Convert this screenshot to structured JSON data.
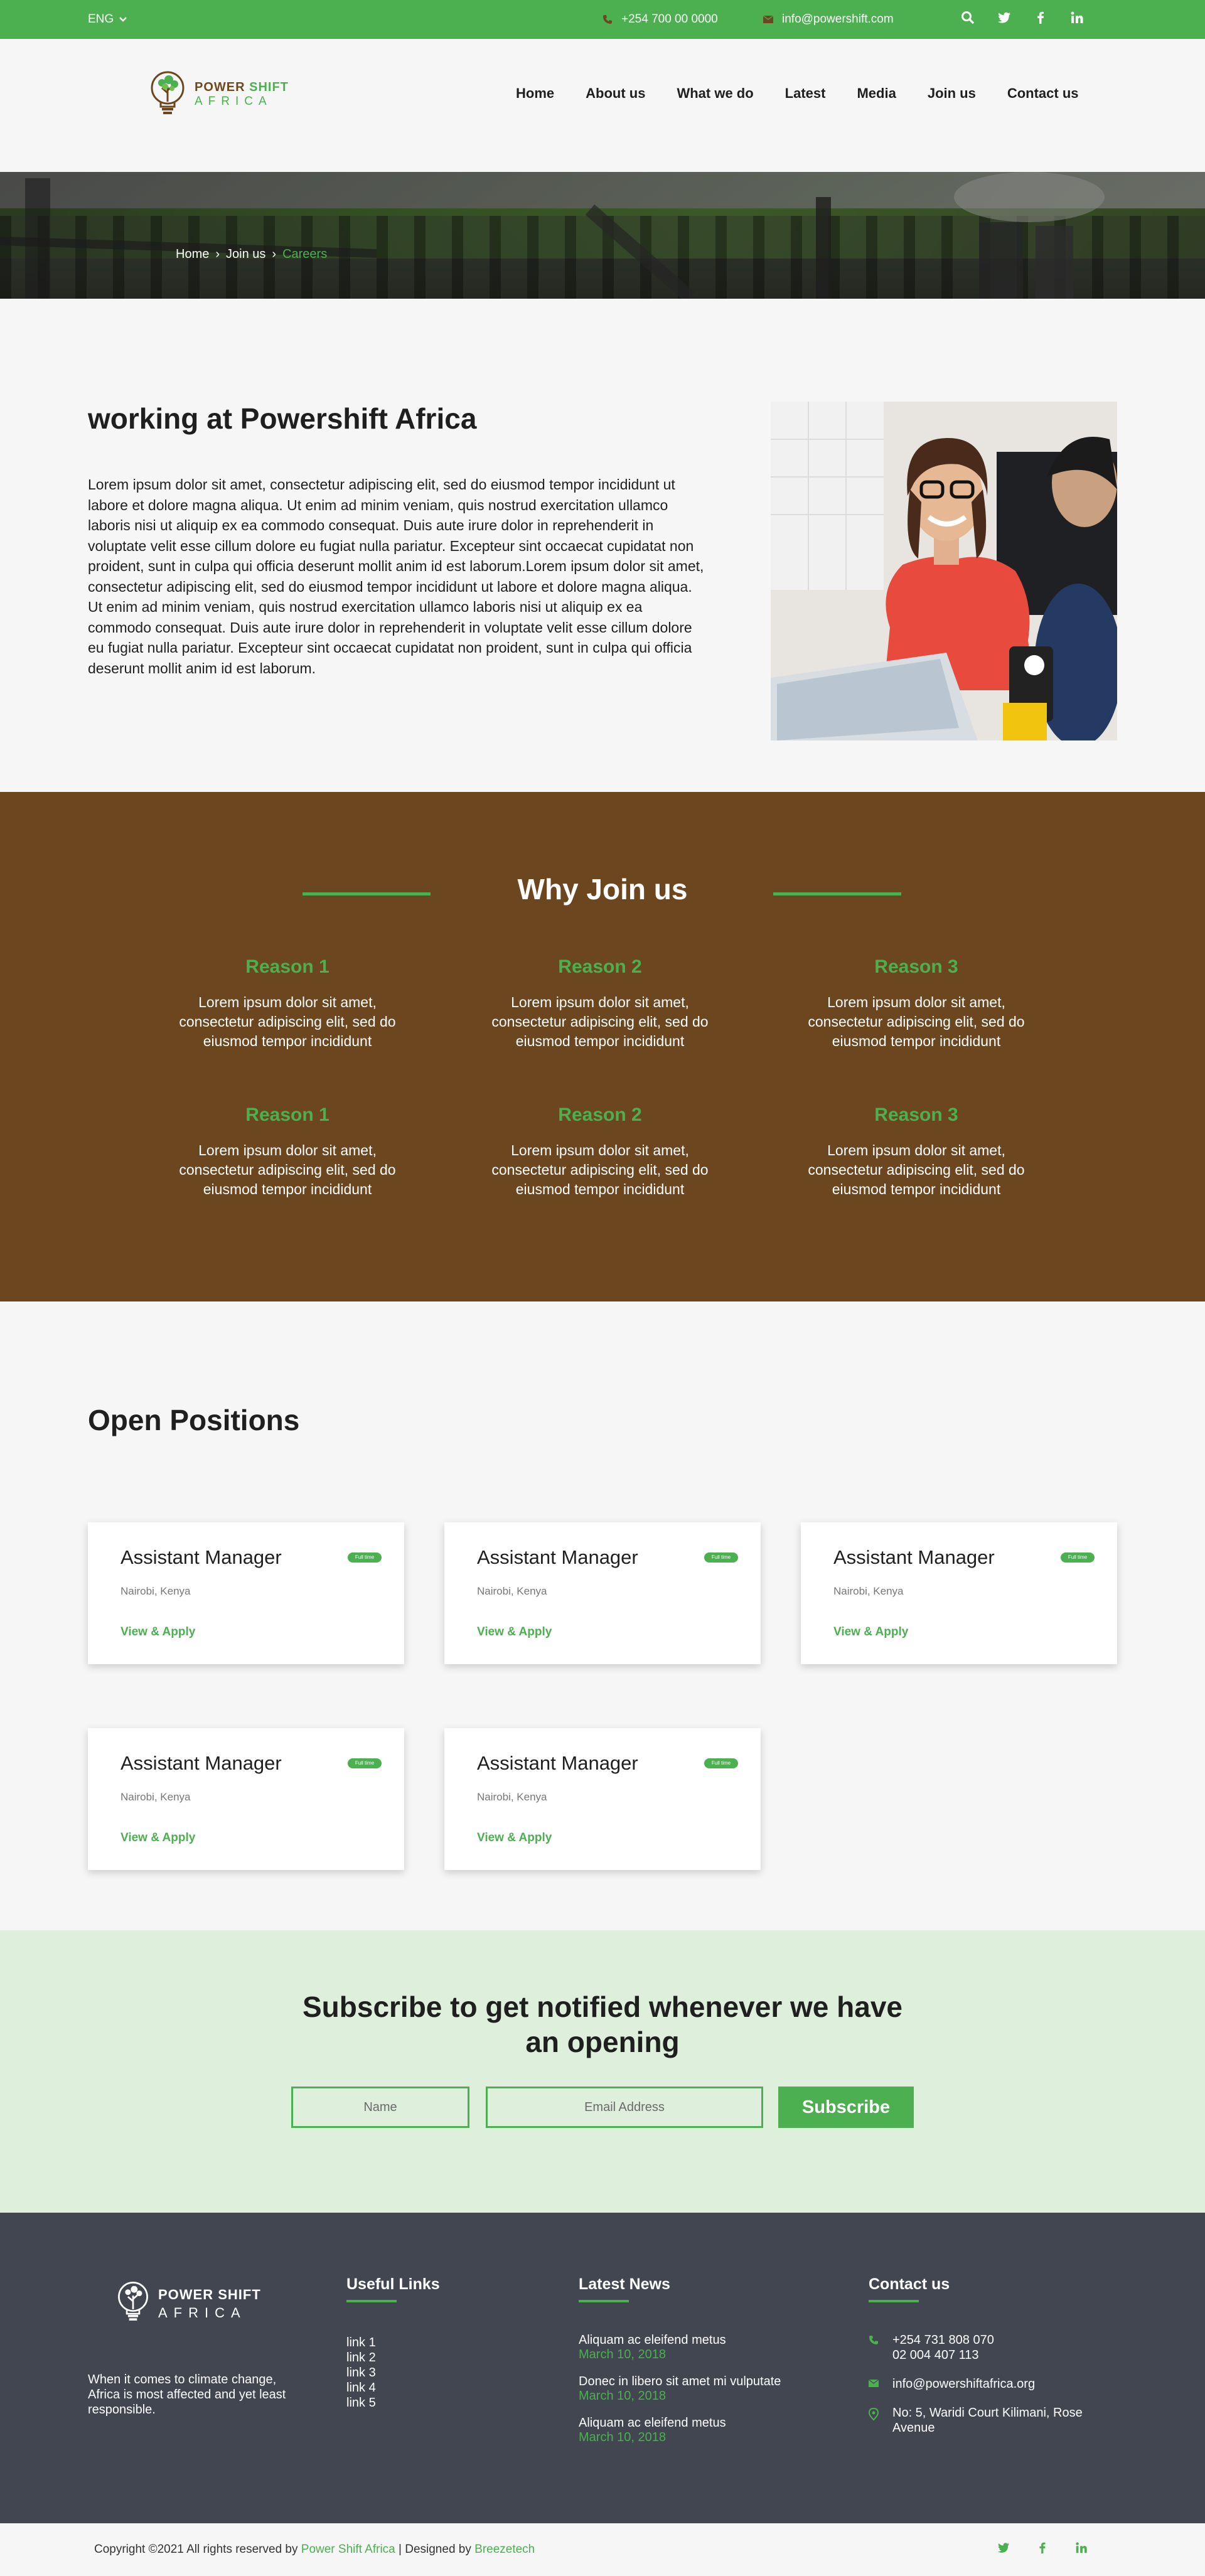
{
  "topbar": {
    "language": "ENG",
    "phone": "+254 700 00 0000",
    "email": "info@powershift.com",
    "icons": [
      "search-icon",
      "twitter-icon",
      "facebook-icon",
      "linkedin-icon"
    ]
  },
  "header": {
    "logo_line1_a": "POWER",
    "logo_line1_b": "SHIFT",
    "logo_line2": "AFRICA",
    "nav": [
      "Home",
      "About us",
      "What we do",
      "Latest",
      "Media",
      "Join us",
      "Contact us"
    ]
  },
  "breadcrumb": {
    "home": "Home",
    "join": "Join us",
    "current": "Careers",
    "separator": "›"
  },
  "working": {
    "title": "working at Powershift Africa",
    "body": "Lorem ipsum dolor sit amet, consectetur adipiscing elit, sed do eiusmod tempor incididunt ut labore et dolore magna aliqua. Ut enim ad minim veniam, quis nostrud exercitation ullamco laboris nisi ut aliquip ex ea commodo consequat. Duis aute irure dolor in reprehenderit in voluptate velit esse cillum dolore eu fugiat nulla pariatur. Excepteur sint occaecat cupidatat non proident, sunt in culpa qui officia deserunt mollit anim id est laborum.Lorem ipsum dolor sit amet, consectetur adipiscing elit, sed do eiusmod tempor incididunt ut labore et dolore magna aliqua. Ut enim ad minim veniam, quis nostrud exercitation ullamco laboris nisi ut aliquip ex ea commodo consequat. Duis aute irure dolor in reprehenderit in voluptate velit esse cillum dolore eu fugiat nulla pariatur. Excepteur sint occaecat cupidatat non proident, sunt in culpa qui officia deserunt mollit anim id est laborum."
  },
  "why": {
    "title": "Why Join us",
    "reasons": [
      {
        "title": "Reason 1",
        "text": "Lorem ipsum dolor sit amet, consectetur adipiscing elit, sed do eiusmod tempor incididunt"
      },
      {
        "title": "Reason 2",
        "text": "Lorem ipsum dolor sit amet, consectetur adipiscing elit, sed do eiusmod tempor incididunt"
      },
      {
        "title": "Reason 3",
        "text": "Lorem ipsum dolor sit amet, consectetur adipiscing elit, sed do eiusmod tempor incididunt"
      },
      {
        "title": "Reason 1",
        "text": "Lorem ipsum dolor sit amet, consectetur adipiscing elit, sed do eiusmod tempor incididunt"
      },
      {
        "title": "Reason 2",
        "text": "Lorem ipsum dolor sit amet, consectetur adipiscing elit, sed do eiusmod tempor incididunt"
      },
      {
        "title": "Reason 3",
        "text": "Lorem ipsum dolor sit amet, consectetur adipiscing elit, sed do eiusmod tempor incididunt"
      }
    ]
  },
  "positions": {
    "title": "Open Positions",
    "cards": [
      {
        "title": "Assistant Manager",
        "badge": "Full time",
        "location": "Nairobi, Kenya",
        "action": "View & Apply"
      },
      {
        "title": "Assistant Manager",
        "badge": "Full time",
        "location": "Nairobi, Kenya",
        "action": "View & Apply"
      },
      {
        "title": "Assistant Manager",
        "badge": "Full time",
        "location": "Nairobi, Kenya",
        "action": "View & Apply"
      },
      {
        "title": "Assistant Manager",
        "badge": "Full time",
        "location": "Nairobi, Kenya",
        "action": "View & Apply"
      },
      {
        "title": "Assistant Manager",
        "badge": "Full time",
        "location": "Nairobi, Kenya",
        "action": "View & Apply"
      }
    ]
  },
  "subscribe": {
    "title_line1": "Subscribe to get notified whenever we have",
    "title_line2": "an opening",
    "name_placeholder": "Name",
    "email_placeholder": "Email Address",
    "button": "Subscribe"
  },
  "footer": {
    "logo_line1": "POWER SHIFT",
    "logo_line2": "AFRICA",
    "tagline": "When it comes to climate change, Africa is most affected and yet least responsible.",
    "useful_links_title": "Useful Links",
    "links": [
      "link 1",
      "link 2",
      "link 3",
      "link 4",
      "link 5"
    ],
    "news_title": "Latest News",
    "news": [
      {
        "title": "Aliquam ac eleifend metus",
        "date": "March 10, 2018"
      },
      {
        "title": "Donec in libero sit amet mi vulputate",
        "date": "March 10, 2018"
      },
      {
        "title": "Aliquam ac eleifend metus",
        "date": "March 10, 2018"
      }
    ],
    "contact_title": "Contact us",
    "phone1": "+254 731 808 070",
    "phone2": "02 004 407 113",
    "email": "info@powershiftafrica.org",
    "address": "No: 5, Waridi Court Kilimani, Rose Avenue"
  },
  "bottom": {
    "copy_prefix": "Copyright ©2021 All rights reserved by",
    "brand": "Power Shift Africa",
    "designed": "| Designed by",
    "designer": "Breezetech"
  },
  "colors": {
    "accent": "#4caf50",
    "brown": "#6b461f",
    "footer": "#414650",
    "subscribe_bg": "#def0dc"
  }
}
